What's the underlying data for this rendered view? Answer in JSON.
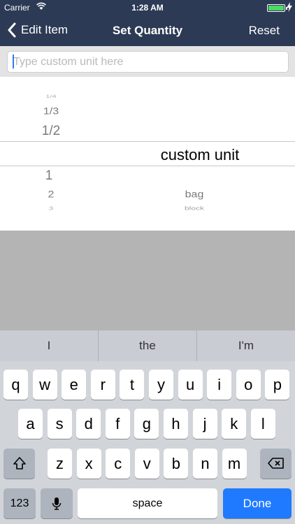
{
  "status": {
    "carrier": "Carrier",
    "time": "1:28 AM"
  },
  "nav": {
    "back_label": "Edit Item",
    "title": "Set Quantity",
    "reset_label": "Reset"
  },
  "field": {
    "placeholder": "Type custom unit here",
    "value": ""
  },
  "picker": {
    "left_column_above": [
      "1/4",
      "1/3",
      "1/2"
    ],
    "selected_unit": "custom unit",
    "left_column_below": [
      "1",
      "2",
      "3"
    ],
    "right_column_below": [
      "bag",
      "block"
    ]
  },
  "keyboard": {
    "suggestions": [
      "I",
      "the",
      "I'm"
    ],
    "row1": [
      "q",
      "w",
      "e",
      "r",
      "t",
      "y",
      "u",
      "i",
      "o",
      "p"
    ],
    "row2": [
      "a",
      "s",
      "d",
      "f",
      "g",
      "h",
      "j",
      "k",
      "l"
    ],
    "row3": [
      "z",
      "x",
      "c",
      "v",
      "b",
      "n",
      "m"
    ],
    "numbers_label": "123",
    "space_label": "space",
    "done_label": "Done"
  },
  "colors": {
    "nav_bg": "#2c3a55",
    "done_blue": "#1f7aff",
    "battery_green": "#4cd964"
  }
}
